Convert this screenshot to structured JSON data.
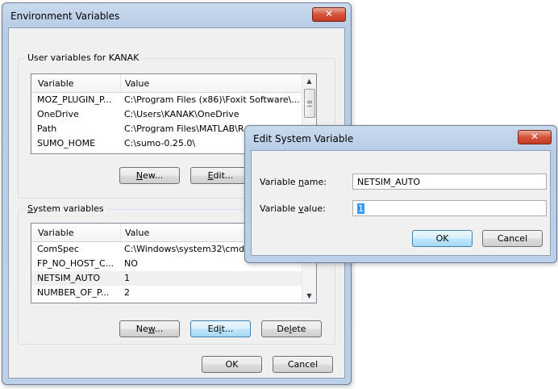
{
  "env_dialog": {
    "title": "Environment Variables",
    "close_label": "✕",
    "user_group_title": "User variables for KANAK",
    "user_columns": [
      "Variable",
      "Value"
    ],
    "user_rows": [
      {
        "variable": "MOZ_PLUGIN_P...",
        "value": "C:\\Program Files (x86)\\Foxit Software\\..."
      },
      {
        "variable": "OneDrive",
        "value": "C:\\Users\\KANAK\\OneDrive"
      },
      {
        "variable": "Path",
        "value": "C:\\Program Files\\MATLAB\\R..."
      },
      {
        "variable": "SUMO_HOME",
        "value": "C:\\sumo-0.25.0\\"
      }
    ],
    "user_buttons": {
      "new": "New...",
      "edit": "Edit..."
    },
    "system_group_title": "System variables",
    "system_columns": [
      "Variable",
      "Value"
    ],
    "system_rows": [
      {
        "variable": "ComSpec",
        "value": "C:\\Windows\\system32\\cmd."
      },
      {
        "variable": "FP_NO_HOST_C...",
        "value": "NO"
      },
      {
        "variable": "NETSIM_AUTO",
        "value": "1"
      },
      {
        "variable": "NUMBER_OF_P...",
        "value": "2"
      }
    ],
    "system_buttons": {
      "new": "New...",
      "edit": "Edit...",
      "delete": "Delete"
    },
    "ok": "OK",
    "cancel": "Cancel"
  },
  "edit_dialog": {
    "title": "Edit System Variable",
    "close_label": "✕",
    "name_label": "Variable name:",
    "name_value": "NETSIM_AUTO",
    "value_label": "Variable value:",
    "value_value": "1",
    "ok": "OK",
    "cancel": "Cancel"
  },
  "icons": {
    "scroll_up": "▲",
    "scroll_down": "▼"
  }
}
